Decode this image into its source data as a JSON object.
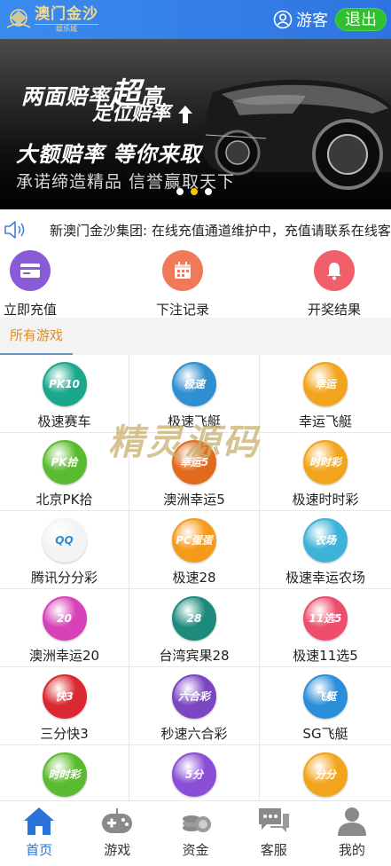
{
  "header": {
    "logo_title": "澳门金沙",
    "logo_subtitle": "娱乐城",
    "user_label": "游客",
    "logout_label": "退出"
  },
  "banner": {
    "line1_a": "两面赔率",
    "line1_b": "超",
    "line1_c": "高",
    "line2": "定位赔率",
    "line3": "大额赔率 等你来取",
    "line4": "承诺缔造精品 信誉赢取天下",
    "slides": 3,
    "active_slide": 2
  },
  "notice": {
    "text": "新澳门金沙集团: 在线充值通道维护中，充值请联系在线客服"
  },
  "quick_actions": [
    {
      "label": "立即充值",
      "icon": "wallet-icon",
      "color": "#8a5bd6"
    },
    {
      "label": "下注记录",
      "icon": "calendar-icon",
      "color": "#f0795a"
    },
    {
      "label": "开奖结果",
      "icon": "bell-icon",
      "color": "#f05f6a"
    }
  ],
  "tabs": {
    "active": "所有游戏"
  },
  "games": [
    {
      "name": "极速赛车",
      "badge": "PK10",
      "color": "#1aa88d"
    },
    {
      "name": "极速飞艇",
      "badge": "极速",
      "color": "#2f8fd0"
    },
    {
      "name": "幸运飞艇",
      "badge": "幸运",
      "color": "#f2a51c"
    },
    {
      "name": "北京PK拾",
      "badge": "PK拾",
      "color": "#5bbb2f"
    },
    {
      "name": "澳洲幸运5",
      "badge": "幸运5",
      "color": "#e26a1c"
    },
    {
      "name": "极速时时彩",
      "badge": "时时彩",
      "color": "#f2a51c"
    },
    {
      "name": "腾讯分分彩",
      "badge": "QQ",
      "color": "#f4f4f4"
    },
    {
      "name": "极速28",
      "badge": "PC蛋蛋",
      "color": "#f59a1c"
    },
    {
      "name": "极速幸运农场",
      "badge": "农场",
      "color": "#3fb2d8"
    },
    {
      "name": "澳洲幸运20",
      "badge": "20",
      "color": "#d941b9"
    },
    {
      "name": "台湾宾果28",
      "badge": "28",
      "color": "#1d8a7c"
    },
    {
      "name": "极速11选5",
      "badge": "11选5",
      "color": "#ee4d6c"
    },
    {
      "name": "三分快3",
      "badge": "快3",
      "color": "#d9282f"
    },
    {
      "name": "秒速六合彩",
      "badge": "六合彩",
      "color": "#7a46c2"
    },
    {
      "name": "SG飞艇",
      "badge": "飞艇",
      "color": "#2a8ed8"
    },
    {
      "name": "",
      "badge": "时时彩",
      "color": "#5bbb2f"
    },
    {
      "name": "",
      "badge": "5分",
      "color": "#8a4fd6"
    },
    {
      "name": "",
      "badge": "分分",
      "color": "#f2a51c"
    }
  ],
  "watermark": "精灵源码",
  "bottom_nav": [
    {
      "label": "首页",
      "icon": "home-icon",
      "active": true
    },
    {
      "label": "游戏",
      "icon": "gamepad-icon",
      "active": false
    },
    {
      "label": "资金",
      "icon": "coins-icon",
      "active": false
    },
    {
      "label": "客服",
      "icon": "chat-icon",
      "active": false
    },
    {
      "label": "我的",
      "icon": "profile-icon",
      "active": false
    }
  ],
  "colors": {
    "header_bg": "#3a8bef",
    "logout_bg": "#2fbf2f",
    "tab_active_text": "#e38b1a",
    "nav_active": "#2a73d8"
  }
}
